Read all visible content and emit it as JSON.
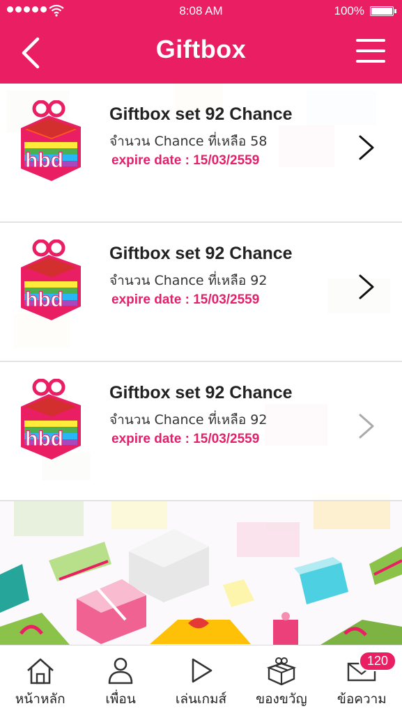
{
  "status_bar": {
    "time": "8:08 AM",
    "battery": "100%",
    "signal_icon": "signal-dots-icon",
    "wifi_icon": "wifi-icon",
    "battery_icon": "battery-icon"
  },
  "header": {
    "title": "Giftbox",
    "back_icon": "back-chevron-icon",
    "menu_icon": "hamburger-menu-icon",
    "color": "#e91e63"
  },
  "giftboxes": [
    {
      "name": "Giftbox set 92 Chance",
      "remaining": "จำนวน Chance ที่เหลือ 58",
      "expire": "expire date : 15/03/2559",
      "logo_text": "hbd"
    },
    {
      "name": "Giftbox set 92 Chance",
      "remaining": "จำนวน Chance ที่เหลือ  92",
      "expire": "expire date : 15/03/2559",
      "logo_text": "hbd"
    },
    {
      "name": "Giftbox set 92 Chance",
      "remaining": "จำนวน Chance ที่เหลือ 92",
      "expire": "expire date : 15/03/2559",
      "logo_text": "hbd"
    }
  ],
  "tab_bar": {
    "items": [
      {
        "label": "หน้าหลัก",
        "icon": "home-icon"
      },
      {
        "label": "เพื่อน",
        "icon": "friend-icon"
      },
      {
        "label": "เล่นเกมส์",
        "icon": "play-icon"
      },
      {
        "label": "ของขวัญ",
        "icon": "gift-icon"
      },
      {
        "label": "ข้อความ",
        "icon": "mail-icon",
        "badge": "120"
      }
    ]
  },
  "colors": {
    "accent": "#e91e63",
    "expire_text": "#e4206b"
  }
}
